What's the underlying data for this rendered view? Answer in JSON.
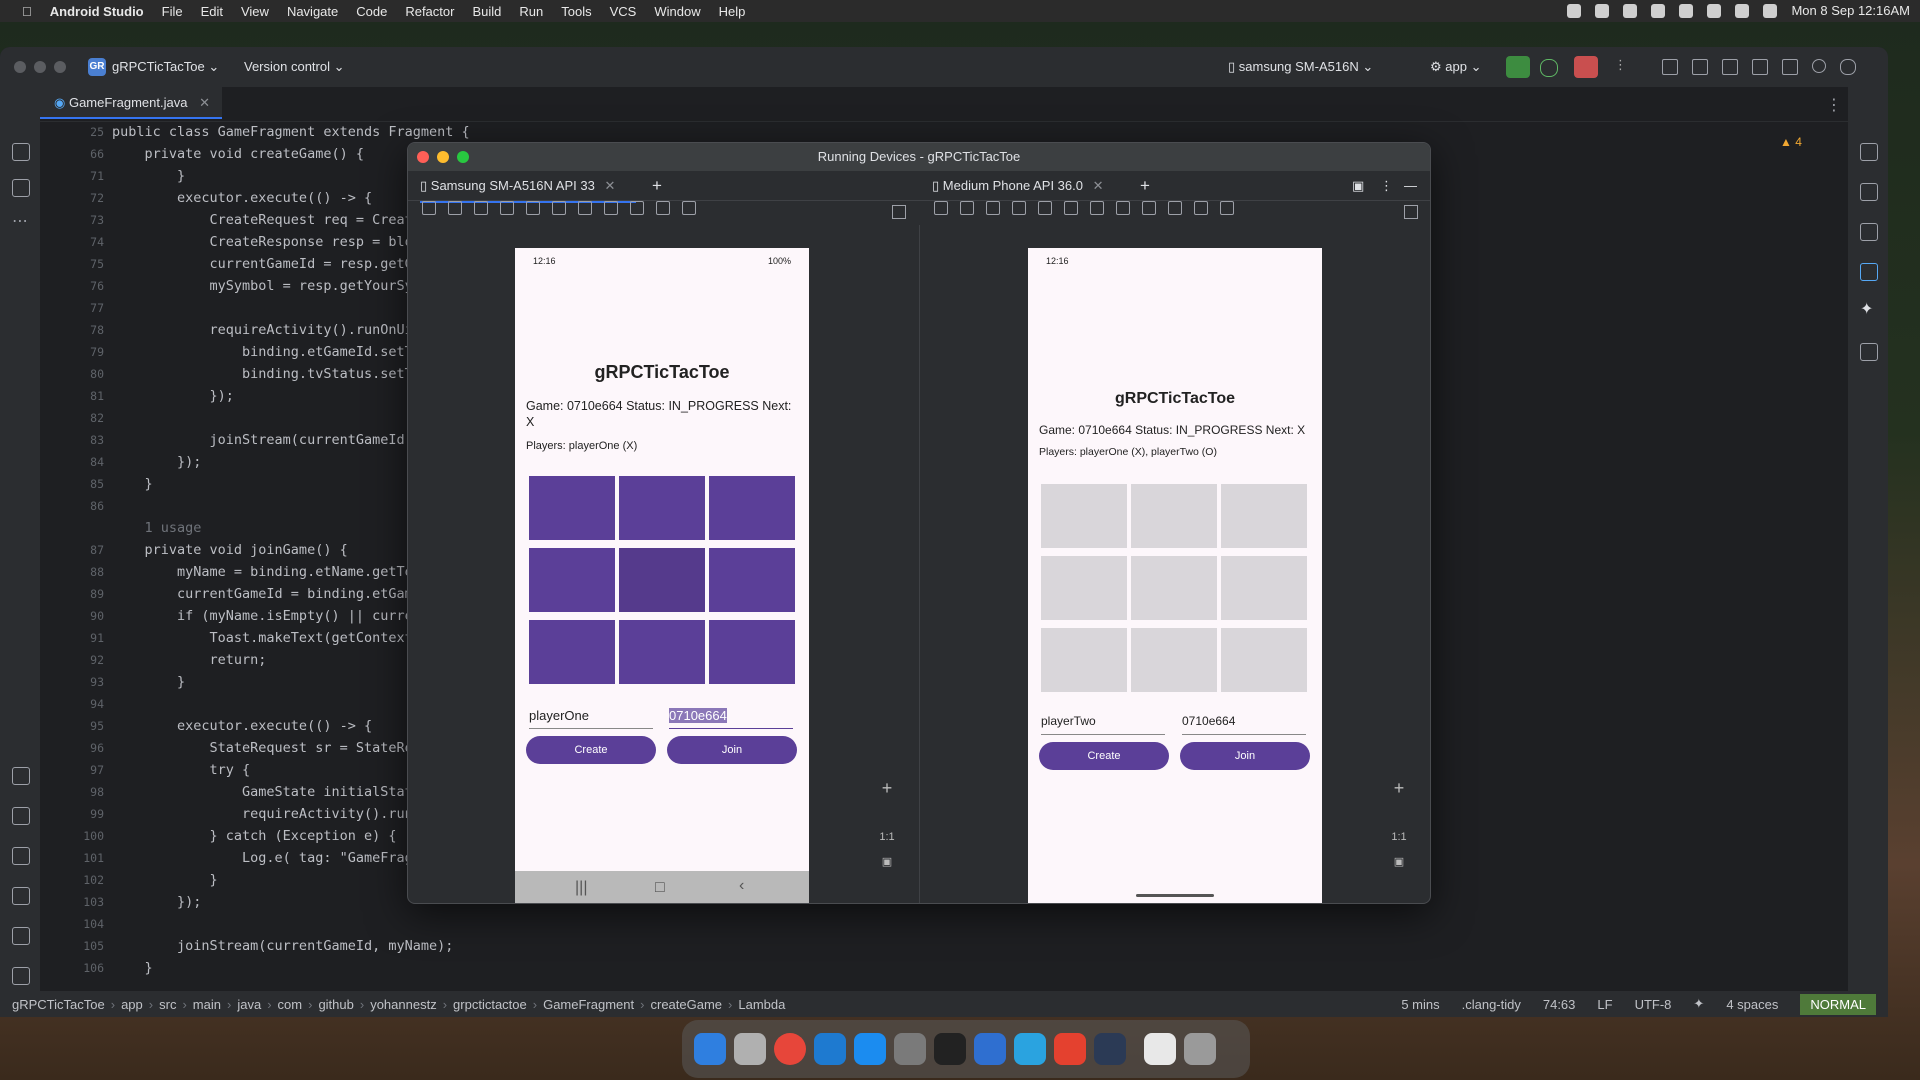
{
  "menubar": {
    "app": "Android Studio",
    "items": [
      "File",
      "Edit",
      "View",
      "Navigate",
      "Code",
      "Refactor",
      "Build",
      "Run",
      "Tools",
      "VCS",
      "Window",
      "Help"
    ],
    "datetime": "Mon 8 Sep  12:16AM"
  },
  "ide": {
    "project": "gRPCTicTacToe",
    "project_badge": "GR",
    "version_control": "Version control",
    "device": "samsung SM-A516N",
    "run_config": "app",
    "file_tab": "GameFragment.java",
    "warnings": "4"
  },
  "code": {
    "line_numbers": [
      "25",
      "66",
      "71",
      "72",
      "73",
      "74",
      "75",
      "76",
      "77",
      "78",
      "79",
      "80",
      "81",
      "82",
      "83",
      "84",
      "85",
      "86",
      "",
      "87",
      "88",
      "89",
      "90",
      "91",
      "92",
      "93",
      "94",
      "95",
      "96",
      "97",
      "98",
      "99",
      "100",
      "101",
      "102",
      "103",
      "104",
      "105",
      "106"
    ],
    "lines": [
      "public class GameFragment extends Fragment {",
      "    private void createGame() {",
      "        }",
      "        executor.execute(() -> {",
      "            CreateRequest req = Creat",
      "            CreateResponse resp = blo",
      "            currentGameId = resp.getG",
      "            mySymbol = resp.getYourSy",
      "",
      "            requireActivity().runOnUi",
      "                binding.etGameId.setT",
      "                binding.tvStatus.setT",
      "            });",
      "",
      "            joinStream(currentGameId,",
      "        });",
      "    }",
      "",
      "    1 usage",
      "    private void joinGame() {",
      "        myName = binding.etName.getTe",
      "        currentGameId = binding.etGam",
      "        if (myName.isEmpty() || curre",
      "            Toast.makeText(getContext",
      "            return;",
      "        }",
      "",
      "        executor.execute(() -> {",
      "            StateRequest sr = StateRe",
      "            try {",
      "                GameState initialStat",
      "                requireActivity().run",
      "            } catch (Exception e) {",
      "                Log.e( tag: \"GameFragm",
      "            }",
      "        });",
      "",
      "        joinStream(currentGameId, myName);",
      "    }"
    ]
  },
  "breadcrumb": [
    "gRPCTicTacToe",
    "app",
    "src",
    "main",
    "java",
    "com",
    "github",
    "yohannestz",
    "grpctictactoe",
    "GameFragment",
    "createGame",
    "Lambda"
  ],
  "status": {
    "time": "5 mins",
    "linter": ".clang-tidy",
    "position": "74:63",
    "line_sep": "LF",
    "encoding": "UTF-8",
    "indent": "4 spaces",
    "mode": "NORMAL"
  },
  "running_devices": {
    "title": "Running Devices - gRPCTicTacToe",
    "tab1": "Samsung SM-A516N API 33",
    "tab2": "Medium Phone API 36.0",
    "zoom_label": "1:1",
    "phone1": {
      "status_time": "12:16",
      "battery": "100%",
      "title": "gRPCTicTacToe",
      "status": "Game: 0710e664 Status: IN_PROGRESS Next: X",
      "players": "Players: playerOne (X)",
      "name_value": "playerOne",
      "game_id_value": "0710e664",
      "create": "Create",
      "join": "Join"
    },
    "phone2": {
      "status_time": "12:16",
      "title": "gRPCTicTacToe",
      "status": "Game: 0710e664 Status: IN_PROGRESS Next: X",
      "players": "Players: playerOne (X), playerTwo (O)",
      "name_value": "playerTwo",
      "game_id_value": "0710e664",
      "create": "Create",
      "join": "Join"
    }
  },
  "colors": {
    "board_active": "#5b3f98",
    "board_inactive": "#d9d6da",
    "button": "#5b3f98"
  }
}
